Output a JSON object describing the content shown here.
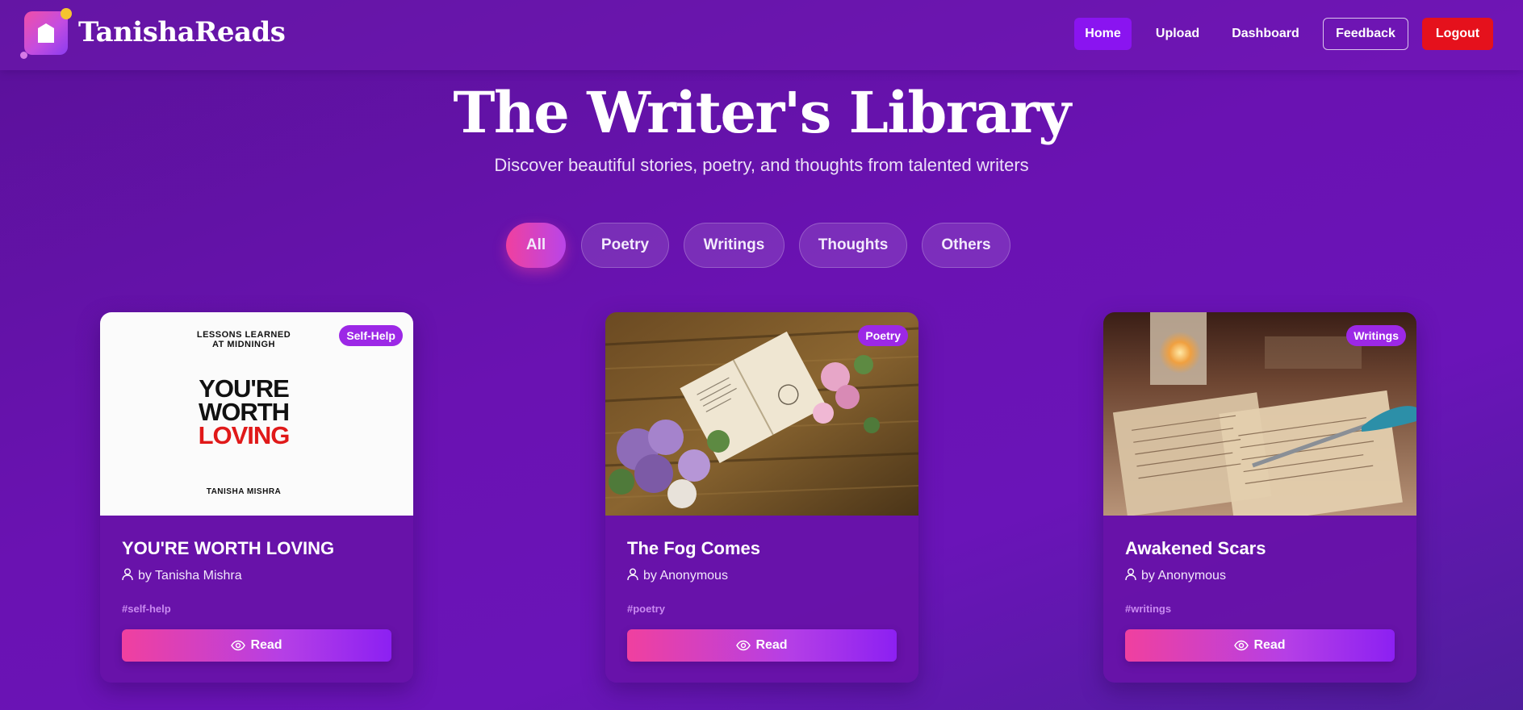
{
  "brand": {
    "name": "TanishaReads"
  },
  "nav": {
    "home": "Home",
    "upload": "Upload",
    "dashboard": "Dashboard",
    "feedback": "Feedback",
    "logout": "Logout"
  },
  "hero": {
    "title": "The Writer's Library",
    "subtitle": "Discover beautiful stories, poetry, and thoughts from talented writers"
  },
  "filters": [
    {
      "label": "All",
      "active": true
    },
    {
      "label": "Poetry",
      "active": false
    },
    {
      "label": "Writings",
      "active": false
    },
    {
      "label": "Thoughts",
      "active": false
    },
    {
      "label": "Others",
      "active": false
    }
  ],
  "cards": [
    {
      "title": "YOU'RE WORTH LOVING",
      "author": "by Tanisha Mishra",
      "category": "Self-Help",
      "tag": "#self-help",
      "read_label": "Read",
      "cover": {
        "top_line": "LESSONS LEARNED",
        "top_line_2": "AT MIDNINGH",
        "title_line_1": "YOU'RE",
        "title_line_2": "WORTH",
        "title_line_3": "LOVING",
        "author": "TANISHA MISHRA"
      }
    },
    {
      "title": "The Fog Comes",
      "author": "by Anonymous",
      "category": "Poetry",
      "tag": "#poetry",
      "read_label": "Read"
    },
    {
      "title": "Awakened Scars",
      "author": "by Anonymous",
      "category": "Writings",
      "tag": "#writings",
      "read_label": "Read"
    }
  ],
  "colors": {
    "accent_pink": "#f0409f",
    "accent_purple": "#8a14f0",
    "logout_red": "#e5111c",
    "background": "#6a12b2"
  },
  "icons": {
    "logo": "house-icon",
    "author": "user-icon",
    "read": "eye-icon"
  }
}
